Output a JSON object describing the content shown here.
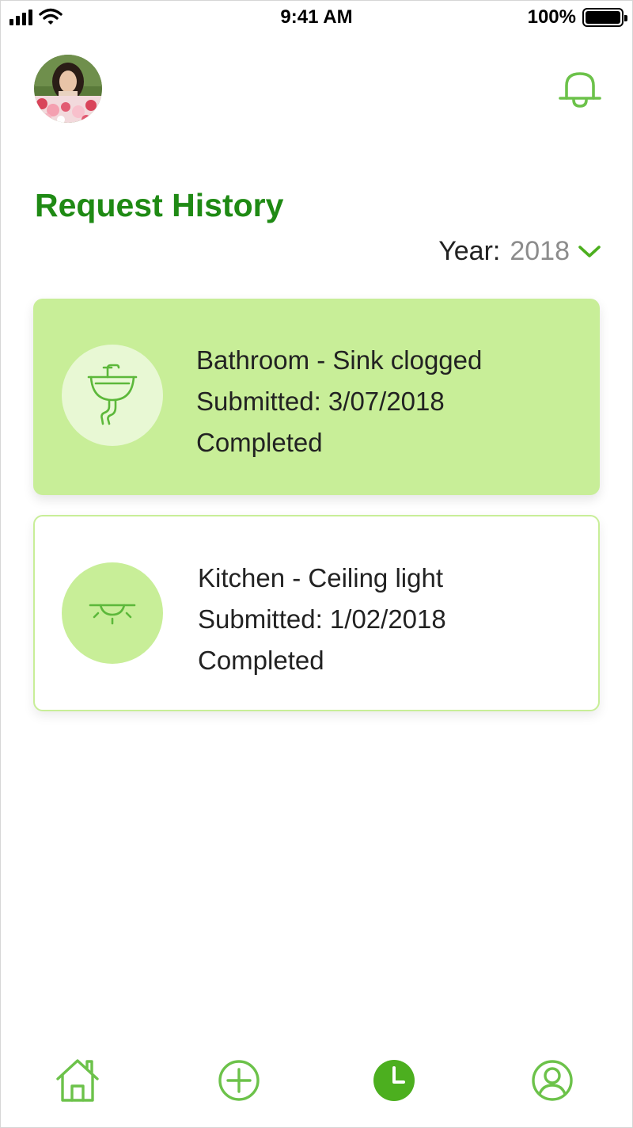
{
  "status_bar": {
    "time": "9:41 AM",
    "battery_percent": "100%",
    "battery_level": 1.0,
    "icons": [
      "signal-icon",
      "wifi-icon",
      "battery-icon"
    ]
  },
  "header": {
    "avatar": "user-avatar",
    "notification_icon": "bell-icon"
  },
  "page": {
    "title": "Request History"
  },
  "filter": {
    "label": "Year:",
    "value": "2018",
    "icon": "chevron-down-icon"
  },
  "requests": [
    {
      "title": "Bathroom - Sink clogged",
      "submitted": "Submitted: 3/07/2018",
      "status": "Completed",
      "icon": "sink-icon",
      "selected": true
    },
    {
      "title": "Kitchen - Ceiling light",
      "submitted": "Submitted: 1/02/2018",
      "status": "Completed",
      "icon": "ceiling-light-icon",
      "selected": false
    }
  ],
  "bottom_nav": {
    "items": [
      {
        "icon": "home-icon",
        "active": false
      },
      {
        "icon": "add-circle-icon",
        "active": false
      },
      {
        "icon": "history-clock-icon",
        "active": true
      },
      {
        "icon": "profile-icon",
        "active": false
      }
    ]
  },
  "colors": {
    "accent": "#1f8a14",
    "icon_green": "#6cc24a",
    "card_selected": "#c8ee98",
    "card_icon_bg": "#e8f8d4",
    "nav_active": "#4caf1f"
  }
}
